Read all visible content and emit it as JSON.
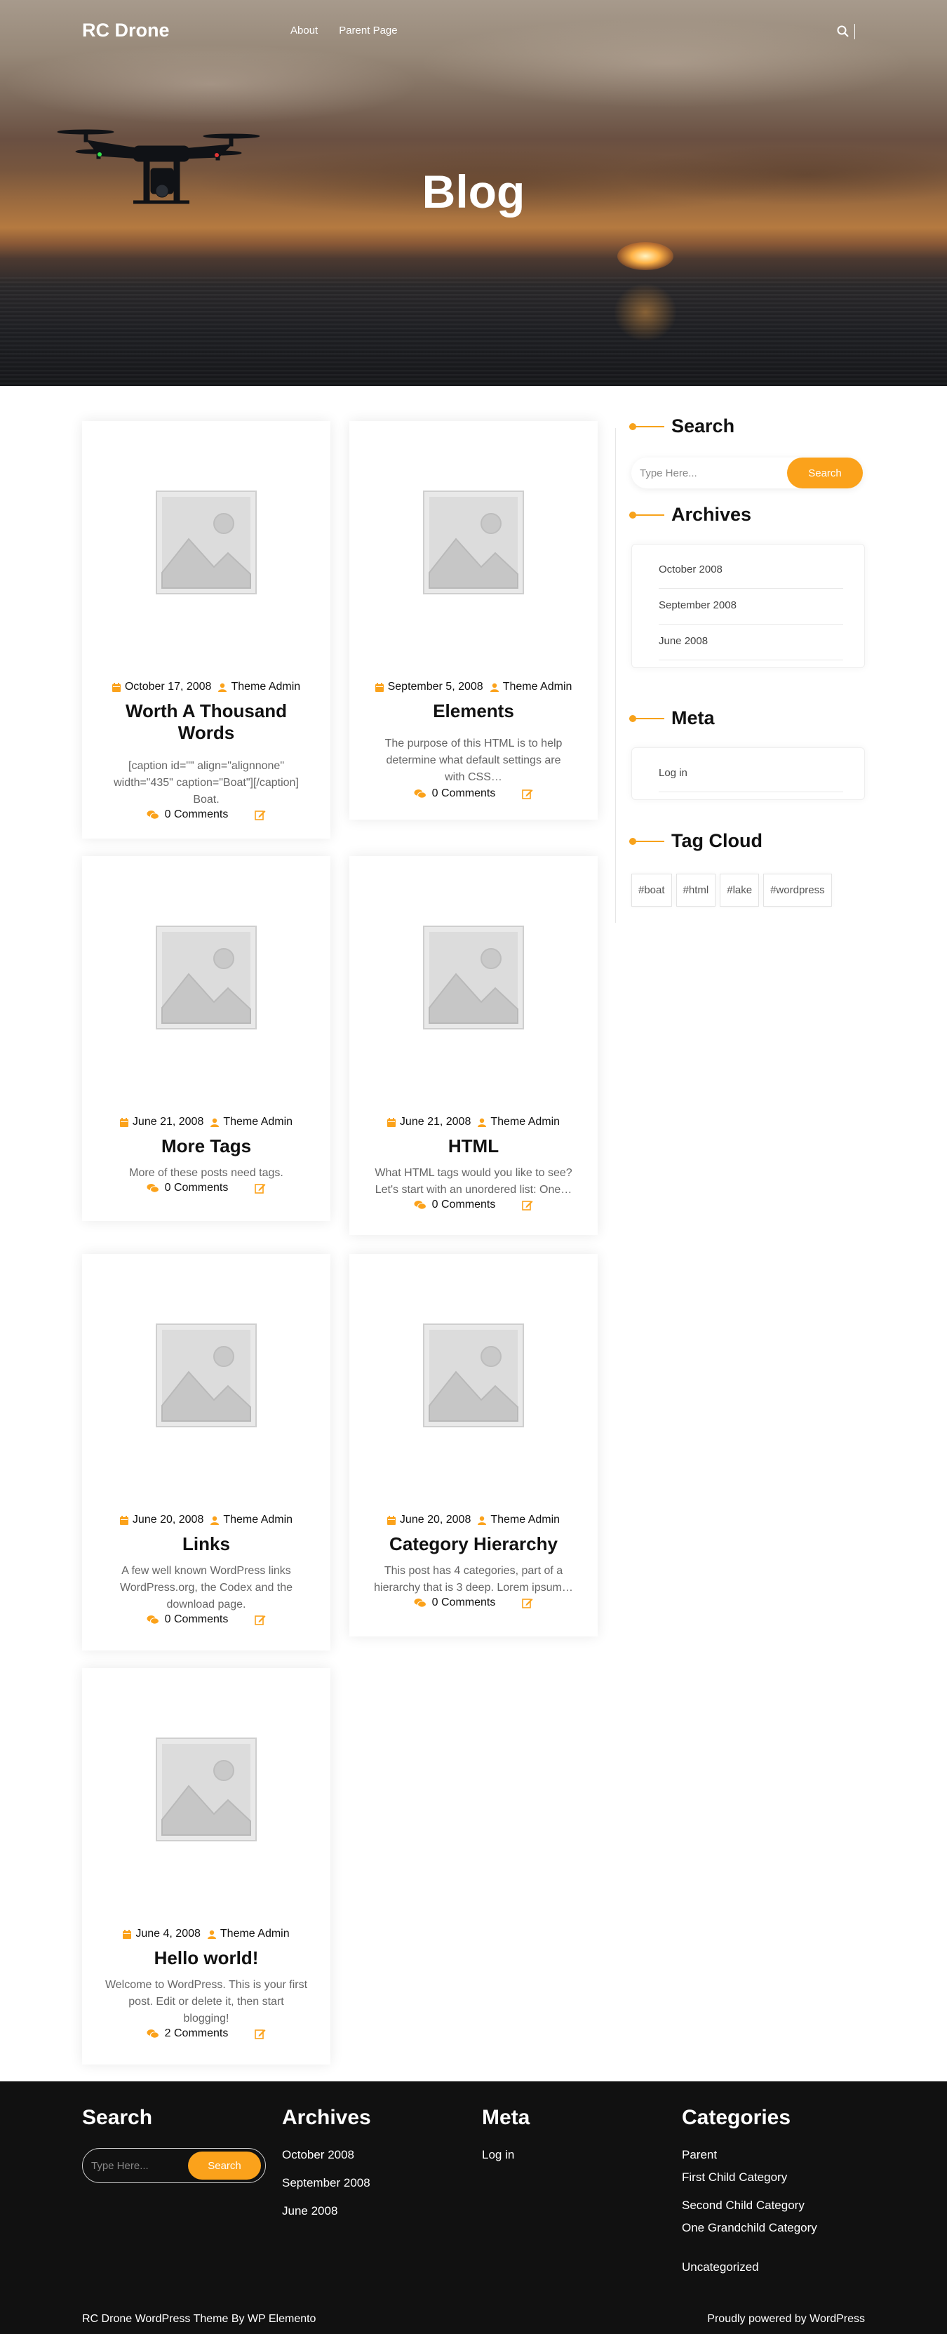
{
  "header": {
    "logo": "RC Drone",
    "nav": [
      "About",
      "Parent Page"
    ],
    "search_icon": "search-icon"
  },
  "hero": {
    "title": "Blog"
  },
  "colors": {
    "accent": "#fba21b",
    "footer_bg": "#111111"
  },
  "posts": [
    {
      "date": "October 17, 2008",
      "author": "Theme Admin",
      "title_lines": [
        "Worth A Thousand",
        "Words"
      ],
      "excerpt_lines": [
        "[caption id=\"\" align=\"alignnone\"",
        "width=\"435\" caption=\"Boat\"][/caption]",
        "Boat."
      ],
      "comments": "0 Comments"
    },
    {
      "date": "September 5, 2008",
      "author": "Theme Admin",
      "title_lines": [
        "Elements"
      ],
      "excerpt_lines": [
        "The purpose of this HTML is to help",
        "determine what default settings are",
        "with CSS…"
      ],
      "comments": "0 Comments"
    },
    {
      "date": "June 21, 2008",
      "author": "Theme Admin",
      "title_lines": [
        "More Tags"
      ],
      "excerpt_lines": [
        "More of these posts need tags."
      ],
      "comments": "0 Comments"
    },
    {
      "date": "June 21, 2008",
      "author": "Theme Admin",
      "title_lines": [
        "HTML"
      ],
      "excerpt_lines": [
        "What HTML tags would you like to see?",
        "Let's start with an unordered list: One…"
      ],
      "comments": "0 Comments"
    },
    {
      "date": "June 20, 2008",
      "author": "Theme Admin",
      "title_lines": [
        "Links"
      ],
      "excerpt_lines": [
        "A few well known WordPress links",
        "WordPress.org, the Codex and the",
        "download page."
      ],
      "comments": "0 Comments"
    },
    {
      "date": "June 20, 2008",
      "author": "Theme Admin",
      "title_lines": [
        "Category Hierarchy"
      ],
      "excerpt_lines": [
        "This post has 4 categories, part of a",
        "hierarchy that is 3 deep. Lorem ipsum…"
      ],
      "comments": "0 Comments"
    },
    {
      "date": "June 4, 2008",
      "author": "Theme Admin",
      "title_lines": [
        "Hello world!"
      ],
      "excerpt_lines": [
        "Welcome to WordPress. This is your first",
        "post. Edit or delete it, then start",
        "blogging!"
      ],
      "comments": "2 Comments"
    }
  ],
  "sidebar": {
    "search_title": "Search",
    "search_placeholder": "Type Here...",
    "search_button": "Search",
    "archives_title": "Archives",
    "archives": [
      "October 2008",
      "September 2008",
      "June 2008"
    ],
    "meta_title": "Meta",
    "meta": [
      "Log in"
    ],
    "tags_title": "Tag Cloud",
    "tags": [
      "#boat",
      "#html",
      "#lake",
      "#wordpress"
    ]
  },
  "footer": {
    "search_title": "Search",
    "search_placeholder": "Type Here...",
    "search_button": "Search",
    "archives_title": "Archives",
    "archives": [
      "October 2008",
      "September 2008",
      "June 2008"
    ],
    "meta_title": "Meta",
    "meta": [
      "Log in"
    ],
    "categories_title": "Categories",
    "categories": [
      "Parent",
      "First Child Category",
      "Second Child Category",
      "One Grandchild Category",
      "Uncategorized"
    ],
    "copyright": "RC Drone WordPress Theme By WP Elemento",
    "powered": "Proudly powered by WordPress"
  }
}
